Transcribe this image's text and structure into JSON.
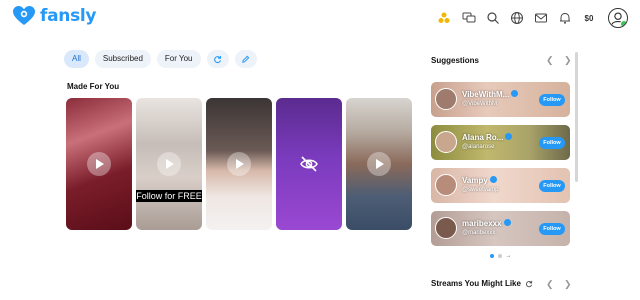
{
  "app": {
    "name": "fansly",
    "brand_color": "#2699f7"
  },
  "header": {
    "icons": [
      "coins-icon",
      "chat-icon",
      "search-icon",
      "globe-icon",
      "mail-icon",
      "bell-icon"
    ],
    "balance": "$0"
  },
  "filters": {
    "chips": [
      "All",
      "Subscribed",
      "For You"
    ],
    "active": "All",
    "icon_buttons": [
      "refresh-icon",
      "edit-icon"
    ]
  },
  "made_for_you": {
    "title": "Made For You",
    "cards": [
      {
        "type": "video"
      },
      {
        "type": "video",
        "overlay_text": "Follow for FREE"
      },
      {
        "type": "video"
      },
      {
        "type": "hidden"
      },
      {
        "type": "video"
      }
    ]
  },
  "suggestions": {
    "title": "Suggestions",
    "items": [
      {
        "name": "VibeWithM...",
        "handle": "@VibeWithM",
        "follow_label": "Follow"
      },
      {
        "name": "Alana Ro...",
        "handle": "@alanarose",
        "follow_label": "Follow"
      },
      {
        "name": "Vampy",
        "handle": "@sweetvamp",
        "follow_label": "Follow"
      },
      {
        "name": "maribexxx",
        "handle": "@maribexxx",
        "follow_label": "Follow"
      }
    ]
  },
  "streams": {
    "title": "Streams You Might Like"
  }
}
